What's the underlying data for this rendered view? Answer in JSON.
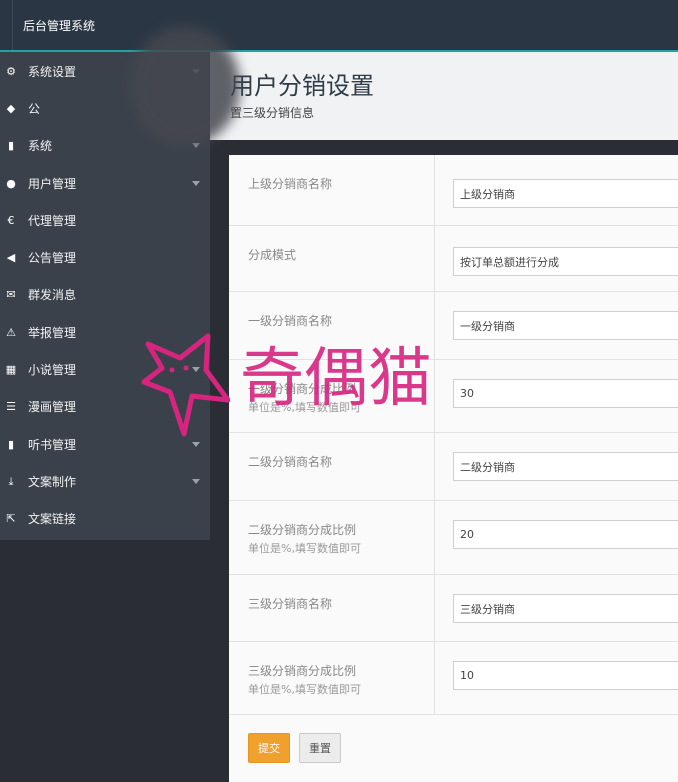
{
  "header": {
    "brand": "后台管理系统"
  },
  "sidebar": {
    "items": [
      {
        "label": "系统设置",
        "icon": "gear-icon",
        "glyph": "⚙",
        "has_submenu": true
      },
      {
        "label": "公",
        "icon": "tag-icon",
        "glyph": "◆",
        "has_submenu": false
      },
      {
        "label": "系统",
        "icon": "bar-chart-icon",
        "glyph": "▮",
        "has_submenu": true
      },
      {
        "label": "用户管理",
        "icon": "user-icon",
        "glyph": "●",
        "has_submenu": true
      },
      {
        "label": "代理管理",
        "icon": "euro-icon",
        "glyph": "€",
        "has_submenu": false
      },
      {
        "label": "公告管理",
        "icon": "megaphone-icon",
        "glyph": "◀",
        "has_submenu": false
      },
      {
        "label": "群发消息",
        "icon": "envelope-icon",
        "glyph": "✉",
        "has_submenu": false
      },
      {
        "label": "举报管理",
        "icon": "warning-icon",
        "glyph": "⚠",
        "has_submenu": false
      },
      {
        "label": "小说管理",
        "icon": "grid-icon",
        "glyph": "▦",
        "has_submenu": true
      },
      {
        "label": "漫画管理",
        "icon": "list-icon",
        "glyph": "☰",
        "has_submenu": false
      },
      {
        "label": "听书管理",
        "icon": "equalizer-icon",
        "glyph": "▮",
        "has_submenu": true
      },
      {
        "label": "文案制作",
        "icon": "download-icon",
        "glyph": "⤓",
        "has_submenu": true
      },
      {
        "label": "文案链接",
        "icon": "share-icon",
        "glyph": "⇱",
        "has_submenu": false
      }
    ]
  },
  "page": {
    "title": "用户分销设置",
    "subtitle": "置三级分销信息"
  },
  "form": {
    "fields": [
      {
        "label": "上级分销商名称",
        "hint": "",
        "value": "上级分销商"
      },
      {
        "label": "分成模式",
        "hint": "",
        "value": "按订单总额进行分成"
      },
      {
        "label": "一级分销商名称",
        "hint": "",
        "value": "一级分销商"
      },
      {
        "label": "一级分销商分成比例",
        "hint": "单位是%,填写数值即可",
        "value": "30"
      },
      {
        "label": "二级分销商名称",
        "hint": "",
        "value": "二级分销商"
      },
      {
        "label": "二级分销商分成比例",
        "hint": "单位是%,填写数值即可",
        "value": "20"
      },
      {
        "label": "三级分销商名称",
        "hint": "",
        "value": "三级分销商"
      },
      {
        "label": "三级分销商分成比例",
        "hint": "单位是%,填写数值即可",
        "value": "10"
      }
    ],
    "submit_label": "提交",
    "reset_label": "重置"
  },
  "watermark": {
    "text": "奇偶猫",
    "color": "#d7247f"
  },
  "colors": {
    "topbar": "#2b3644",
    "accent": "#1fa5a0",
    "sidebar": "#3b414b",
    "submit": "#f0a02c"
  }
}
